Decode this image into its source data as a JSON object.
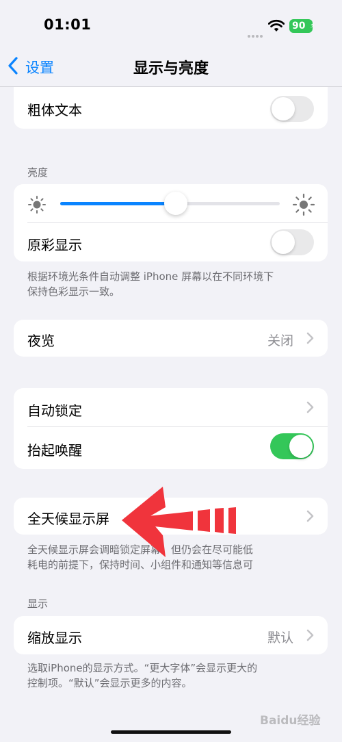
{
  "status_bar": {
    "time": "01:01",
    "battery": "90"
  },
  "nav": {
    "back_label": "设置",
    "title": "显示与亮度"
  },
  "bold_text": {
    "label": "粗体文本",
    "enabled": false
  },
  "brightness": {
    "header": "亮度",
    "level": 0.5,
    "true_tone_label": "原彩显示",
    "true_tone_enabled": false,
    "footnote_line1": "根据环境光条件自动调整 iPhone 屏幕以在不同环境下",
    "footnote_line2": "保持色彩显示一致。"
  },
  "night_shift": {
    "label": "夜览",
    "value": "关闭"
  },
  "lock": {
    "auto_lock_label": "自动锁定",
    "raise_to_wake_label": "抬起唤醒",
    "raise_to_wake_enabled": true
  },
  "always_on": {
    "label": "全天候显示屏",
    "footnote_line1": "全天候显示屏会调暗锁定屏幕，但仍会在尽可能低",
    "footnote_line2": "耗电的前提下，保持时间、小组件和通知等信息可"
  },
  "display": {
    "header": "显示",
    "zoom_label": "缩放显示",
    "zoom_value": "默认",
    "footnote_line1": "选取iPhone的显示方式。“更大字体”会显示更大的",
    "footnote_line2": "控制项。“默认”会显示更多的内容。"
  },
  "colors": {
    "accent": "#0a84ff",
    "toggle_on": "#34c759",
    "annotation_arrow": "#f0343c"
  },
  "watermark": "Baidu经验"
}
